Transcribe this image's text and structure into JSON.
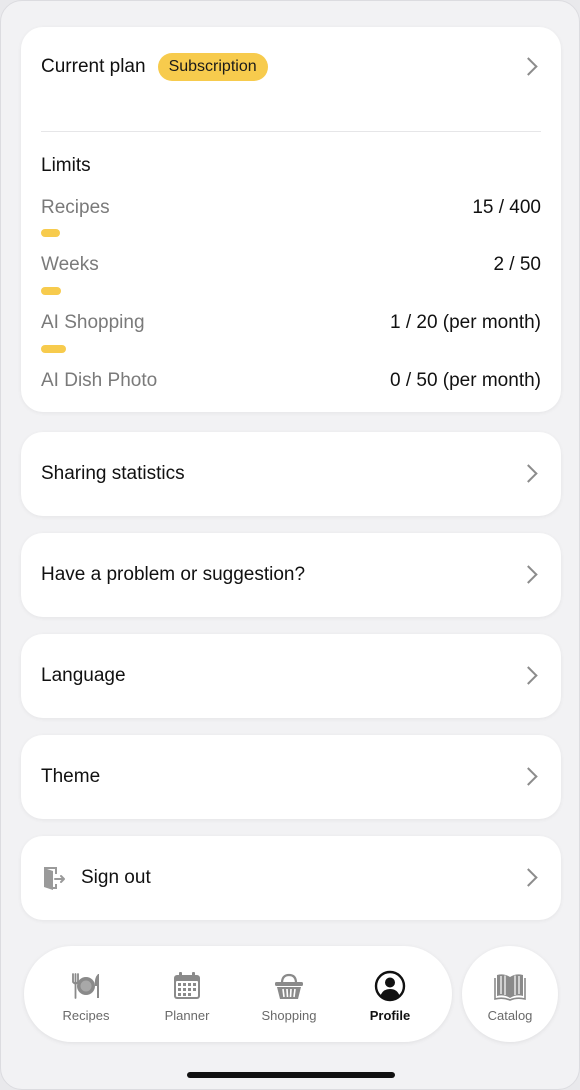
{
  "plan": {
    "title": "Current plan",
    "badge": "Subscription"
  },
  "limits": {
    "title": "Limits",
    "items": [
      {
        "label": "Recipes",
        "value": "15 / 400",
        "fill": 0.0375
      },
      {
        "label": "Weeks",
        "value": "2 / 50",
        "fill": 0.04
      },
      {
        "label": "AI Shopping",
        "value": "1 / 20 (per month)",
        "fill": 0.05
      },
      {
        "label": "AI Dish Photo",
        "value": "0 / 50 (per month)",
        "fill": 0
      }
    ]
  },
  "menu": {
    "sharing": "Sharing statistics",
    "feedback": "Have a problem or suggestion?",
    "language": "Language",
    "theme": "Theme",
    "signout": "Sign out"
  },
  "tabs": {
    "recipes": "Recipes",
    "planner": "Planner",
    "shopping": "Shopping",
    "profile": "Profile",
    "catalog": "Catalog",
    "active": "profile"
  },
  "colors": {
    "accent": "#f7cb4d",
    "background": "#f2f2f4"
  }
}
